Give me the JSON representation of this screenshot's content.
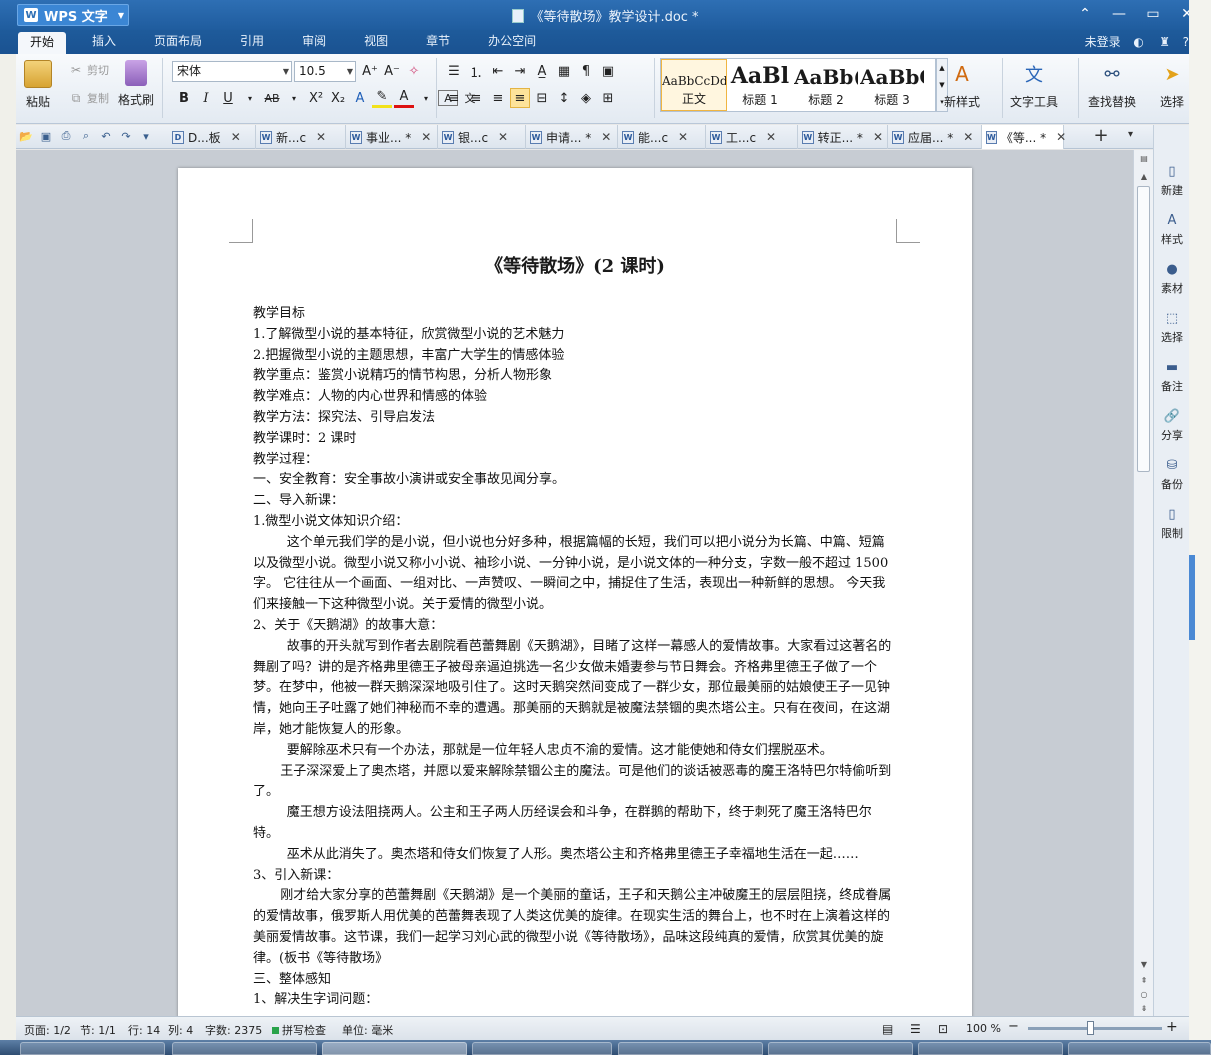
{
  "app": {
    "menu_button": "WPS 文字",
    "doc_title": "《等待散场》教学设计.doc *"
  },
  "menu_tabs": [
    "开始",
    "插入",
    "页面布局",
    "引用",
    "审阅",
    "视图",
    "章节",
    "办公空间"
  ],
  "account": {
    "login": "未登录",
    "help": "?"
  },
  "ribbon": {
    "paste": "粘贴",
    "cut": "剪切",
    "copy": "复制",
    "format_painter": "格式刷",
    "font_name": "宋体",
    "font_size": "10.5",
    "styles": [
      {
        "sample": "AaBbCcDd",
        "label": "正文"
      },
      {
        "sample": "AaBl",
        "label": "标题 1"
      },
      {
        "sample": "AaBb(",
        "label": "标题 2"
      },
      {
        "sample": "AaBbC",
        "label": "标题 3"
      }
    ],
    "new_style": "新样式",
    "text_tools": "文字工具",
    "find_replace": "查找替换",
    "select": "选择"
  },
  "doc_tabs": [
    {
      "label": "D...板",
      "modified": false
    },
    {
      "label": "新...c",
      "modified": false
    },
    {
      "label": "事业... *",
      "modified": true
    },
    {
      "label": "银...c",
      "modified": false
    },
    {
      "label": "申请... *",
      "modified": true
    },
    {
      "label": "能...c",
      "modified": false
    },
    {
      "label": "工...c",
      "modified": false
    },
    {
      "label": "转正... *",
      "modified": true
    },
    {
      "label": "应届... *",
      "modified": true
    },
    {
      "label": "《等... *",
      "modified": true
    }
  ],
  "document": {
    "heading": "《等待散场》(2 课时)",
    "paragraphs": [
      {
        "text": "教学目标",
        "style": "plain"
      },
      {
        "text": "1.了解微型小说的基本特征，欣赏微型小说的艺术魅力",
        "style": "plain"
      },
      {
        "text": "2.把握微型小说的主题思想，丰富广大学生的情感体验",
        "style": "plain"
      },
      {
        "text": "教学重点：鉴赏小说精巧的情节构思，分析人物形象",
        "style": "plain"
      },
      {
        "text": "教学难点：人物的内心世界和情感的体验",
        "style": "plain"
      },
      {
        "text": "教学方法：探究法、引导启发法",
        "style": "plain"
      },
      {
        "text": "教学课时：2 课时",
        "style": "plain"
      },
      {
        "text": "教学过程：",
        "style": "plain"
      },
      {
        "text": "一、安全教育：安全事故小演讲或安全事故见闻分享。",
        "style": "plain"
      },
      {
        "text": "二、导入新课：",
        "style": "plain"
      },
      {
        "text": "1.微型小说文体知识介绍：",
        "style": "plain"
      },
      {
        "text": "这个单元我们学的是小说，但小说也分好多种，根据篇幅的长短，我们可以把小说分为长篇、中篇、短篇以及微型小说。微型小说又称小小说、袖珍小说、一分钟小说，是小说文体的一种分支，字数一般不超过 1500 字。 它往往从一个画面、一组对比、一声赞叹、一瞬间之中，捕捉住了生活，表现出一种新鲜的思想。 今天我们来接触一下这种微型小说。关于爱情的微型小说。",
        "style": "indent"
      },
      {
        "text": "2、关于《天鹅湖》的故事大意：",
        "style": "plain"
      },
      {
        "text": "故事的开头就写到作者去剧院看芭蕾舞剧《天鹅湖》，目睹了这样一幕感人的爱情故事。大家看过这著名的舞剧了吗？讲的是齐格弗里德王子被母亲逼迫挑选一名少女做未婚妻参与节日舞会。齐格弗里德王子做了一个梦。在梦中，他被一群天鹅深深地吸引住了。这时天鹅突然间变成了一群少女，那位最美丽的姑娘使王子一见钟情，她向王子吐露了她们神秘而不幸的遭遇。那美丽的天鹅就是被魔法禁锢的奥杰塔公主。只有在夜间，在这湖岸，她才能恢复人的形象。",
        "style": "indent"
      },
      {
        "text": "要解除巫术只有一个办法，那就是一位年轻人忠贞不渝的爱情。这才能使她和侍女们摆脱巫术。",
        "style": "indent"
      },
      {
        "text": "王子深深爱上了奥杰塔，并愿以爱来解除禁锢公主的魔法。可是他们的谈话被恶毒的魔王洛特巴尔特偷听到了。",
        "style": "indent2"
      },
      {
        "text": "魔王想方设法阻挠两人。公主和王子两人历经误会和斗争，在群鹅的帮助下，终于刺死了魔王洛特巴尔特。",
        "style": "indent"
      },
      {
        "text": "巫术从此消失了。奥杰塔和侍女们恢复了人形。奥杰塔公主和齐格弗里德王子幸福地生活在一起……",
        "style": "indent"
      },
      {
        "text": "3、引入新课：",
        "style": "plain"
      },
      {
        "text": "刚才给大家分享的芭蕾舞剧《天鹅湖》是一个美丽的童话，王子和天鹅公主冲破魔王的层层阻挠，终成眷属的爱情故事，俄罗斯人用优美的芭蕾舞表现了人类这优美的旋律。在现实生活的舞台上，也不时在上演着这样的美丽爱情故事。这节课，我们一起学习刘心武的微型小说《等待散场》，品味这段纯真的爱情，欣赏其优美的旋律。(板书《等待散场》",
        "style": "indent2"
      },
      {
        "text": "三、整体感知",
        "style": "plain"
      },
      {
        "text": "1、解决生字词问题：",
        "style": "plain"
      }
    ]
  },
  "right_panel": [
    "新建",
    "样式",
    "素材",
    "选择",
    "备注",
    "分享",
    "备份",
    "限制"
  ],
  "status": {
    "page": "页面: 1/2",
    "section": "节: 1/1",
    "row": "行: 14",
    "col": "列: 4",
    "words": "字数: 2375",
    "spell": "拼写检查",
    "unit": "单位: 毫米",
    "zoom": "100 %",
    "zoom_value": 1.0
  }
}
